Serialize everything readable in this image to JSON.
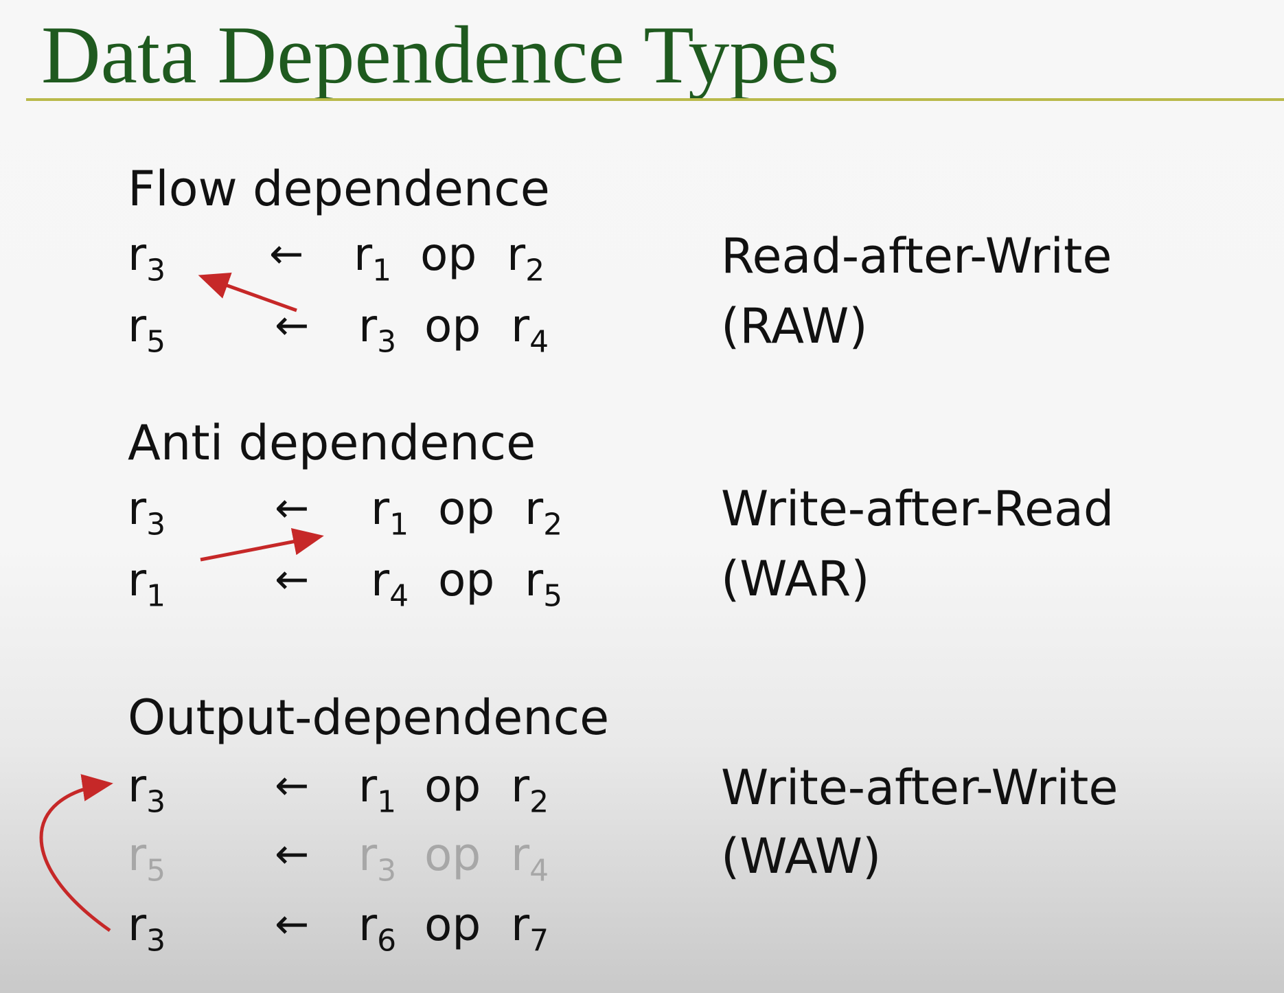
{
  "title": "Data Dependence Types",
  "sections": {
    "flow": {
      "heading": "Flow dependence",
      "row1": {
        "dst": "r",
        "dst_sub": "3",
        "arrow": "←",
        "src1": "r",
        "src1_sub": "1",
        "op": "op",
        "src2": "r",
        "src2_sub": "2"
      },
      "row2": {
        "dst": "r",
        "dst_sub": "5",
        "arrow": "←",
        "src1": "r",
        "src1_sub": "3",
        "op": "op",
        "src2": "r",
        "src2_sub": "4"
      },
      "desc_line1": "Read-after-Write",
      "desc_line2": "(RAW)"
    },
    "anti": {
      "heading": "Anti dependence",
      "row1": {
        "dst": "r",
        "dst_sub": "3",
        "arrow": "←",
        "src1": "r",
        "src1_sub": "1",
        "op": "op",
        "src2": "r",
        "src2_sub": "2"
      },
      "row2": {
        "dst": "r",
        "dst_sub": "1",
        "arrow": "←",
        "src1": "r",
        "src1_sub": "4",
        "op": "op",
        "src2": "r",
        "src2_sub": "5"
      },
      "desc_line1": "Write-after-Read",
      "desc_line2": "(WAR)"
    },
    "output": {
      "heading": "Output-dependence",
      "row1": {
        "dst": "r",
        "dst_sub": "3",
        "arrow": "←",
        "src1": "r",
        "src1_sub": "1",
        "op": "op",
        "src2": "r",
        "src2_sub": "2"
      },
      "row2": {
        "dst": "r",
        "dst_sub": "5",
        "arrow": "←",
        "src1": "r",
        "src1_sub": "3",
        "op": "op",
        "src2": "r",
        "src2_sub": "4"
      },
      "row3": {
        "dst": "r",
        "dst_sub": "3",
        "arrow": "←",
        "src1": "r",
        "src1_sub": "6",
        "op": "op",
        "src2": "r",
        "src2_sub": "7"
      },
      "desc_line1": "Write-after-Write",
      "desc_line2": "(WAW)"
    }
  },
  "colors": {
    "title": "#1f5a1f",
    "rule": "#b9b94a",
    "annotation_arrow": "#c62828",
    "faded_text": "#a7a7a7"
  }
}
